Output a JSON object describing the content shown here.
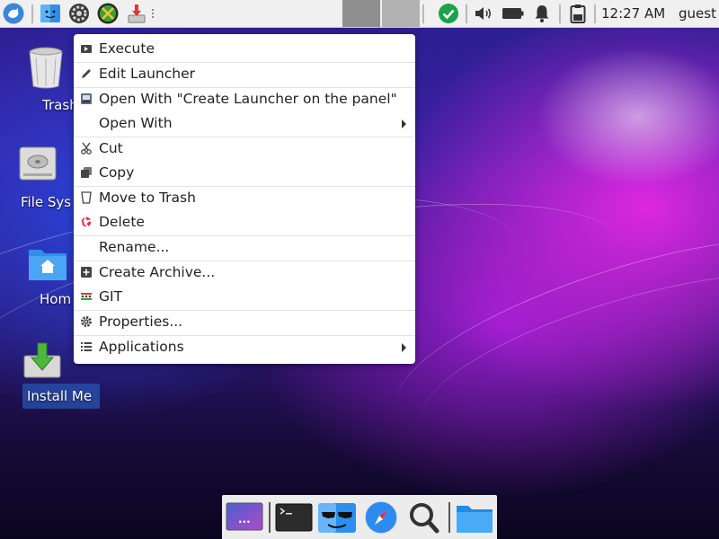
{
  "top_panel": {
    "clock": "12:27 AM",
    "user": "guest",
    "launchers": [
      {
        "name": "whisker-menu-icon"
      },
      {
        "name": "file-manager-icon"
      },
      {
        "name": "settings-icon"
      },
      {
        "name": "tools-icon"
      },
      {
        "name": "install-icon"
      }
    ],
    "tray": [
      {
        "name": "checkmark-icon",
        "color": "#1aa34a"
      },
      {
        "name": "volume-icon"
      },
      {
        "name": "battery-icon"
      },
      {
        "name": "notification-bell-icon"
      },
      {
        "name": "clipboard-icon"
      }
    ]
  },
  "desktop_icons": [
    {
      "label": "Trash",
      "icon": "trash-icon"
    },
    {
      "label": "File Sys",
      "icon": "drive-icon"
    },
    {
      "label": "Hom",
      "icon": "home-folder-icon"
    },
    {
      "label": "Install Me",
      "icon": "install-me-icon",
      "selected": true
    }
  ],
  "context_menu": {
    "items": [
      {
        "label": "Execute",
        "icon": "execute-icon"
      },
      {
        "label": "Edit Launcher",
        "icon": "pencil-icon"
      },
      {
        "label": "Open With \"Create Launcher on the panel\"",
        "icon": "launcher-app-icon"
      },
      {
        "label": "Open With",
        "icon": "",
        "submenu": true
      },
      {
        "label": "Cut",
        "icon": "scissors-icon"
      },
      {
        "label": "Copy",
        "icon": "copy-icon"
      },
      {
        "label": "Move to Trash",
        "icon": "trash-small-icon"
      },
      {
        "label": "Delete",
        "icon": "delete-icon",
        "icon_color": "#e0324b"
      },
      {
        "label": "Rename...",
        "icon": ""
      },
      {
        "label": "Create Archive...",
        "icon": "archive-icon"
      },
      {
        "label": "GIT",
        "icon": "git-icon"
      },
      {
        "label": "Properties...",
        "icon": "gear-icon"
      },
      {
        "label": "Applications",
        "icon": "list-icon",
        "submenu": true
      }
    ]
  },
  "dock": {
    "items": [
      {
        "name": "workspace-switcher-icon"
      },
      {
        "name": "terminal-icon"
      },
      {
        "name": "finder-face-icon"
      },
      {
        "name": "compass-browser-icon"
      },
      {
        "name": "magnifier-search-icon"
      },
      {
        "name": "folder-icon"
      }
    ],
    "workspace_label": "..."
  }
}
